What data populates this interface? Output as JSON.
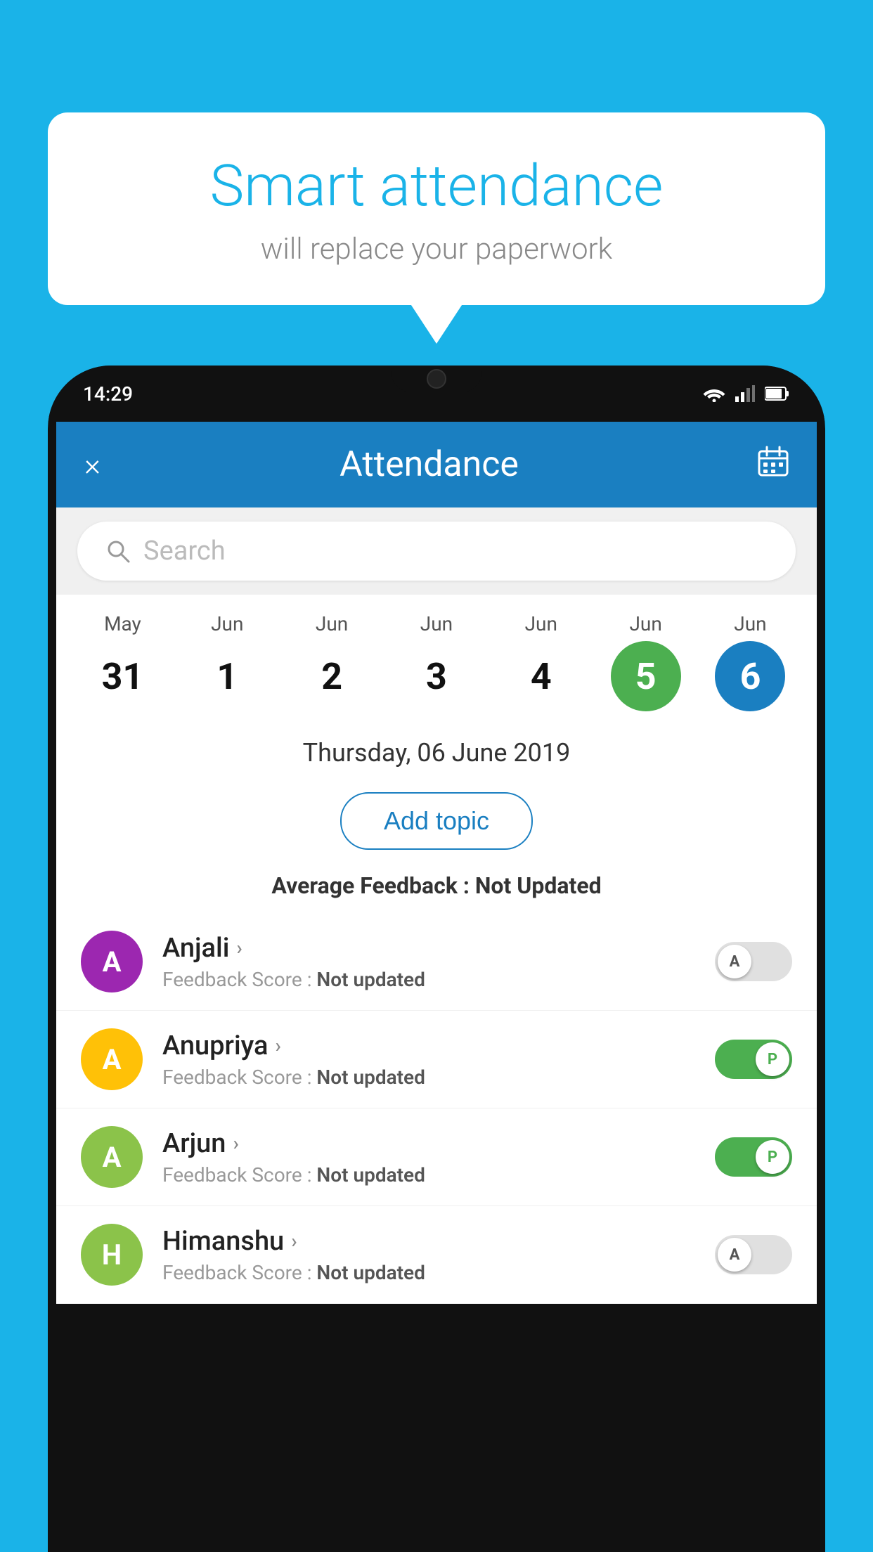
{
  "background_color": "#1ab3e8",
  "speech_bubble": {
    "title": "Smart attendance",
    "subtitle": "will replace your paperwork"
  },
  "phone": {
    "status_bar": {
      "time": "14:29"
    },
    "toolbar": {
      "title": "Attendance",
      "close_label": "×",
      "calendar_icon": "📅"
    },
    "search": {
      "placeholder": "Search"
    },
    "calendar": {
      "days": [
        {
          "month": "May",
          "num": "31",
          "style": "normal"
        },
        {
          "month": "Jun",
          "num": "1",
          "style": "normal"
        },
        {
          "month": "Jun",
          "num": "2",
          "style": "normal"
        },
        {
          "month": "Jun",
          "num": "3",
          "style": "normal"
        },
        {
          "month": "Jun",
          "num": "4",
          "style": "normal"
        },
        {
          "month": "Jun",
          "num": "5",
          "style": "green"
        },
        {
          "month": "Jun",
          "num": "6",
          "style": "blue"
        }
      ]
    },
    "selected_date": "Thursday, 06 June 2019",
    "add_topic_label": "Add topic",
    "avg_feedback": {
      "label": "Average Feedback :",
      "value": "Not Updated"
    },
    "students": [
      {
        "name": "Anjali",
        "avatar_letter": "A",
        "avatar_color": "#9c27b0",
        "feedback_label": "Feedback Score :",
        "feedback_value": "Not updated",
        "toggle": "off",
        "toggle_letter": "A"
      },
      {
        "name": "Anupriya",
        "avatar_letter": "A",
        "avatar_color": "#ffc107",
        "feedback_label": "Feedback Score :",
        "feedback_value": "Not updated",
        "toggle": "on",
        "toggle_letter": "P"
      },
      {
        "name": "Arjun",
        "avatar_letter": "A",
        "avatar_color": "#8bc34a",
        "feedback_label": "Feedback Score :",
        "feedback_value": "Not updated",
        "toggle": "on",
        "toggle_letter": "P"
      },
      {
        "name": "Himanshu",
        "avatar_letter": "H",
        "avatar_color": "#8bc34a",
        "feedback_label": "Feedback Score :",
        "feedback_value": "Not updated",
        "toggle": "off",
        "toggle_letter": "A"
      }
    ]
  }
}
